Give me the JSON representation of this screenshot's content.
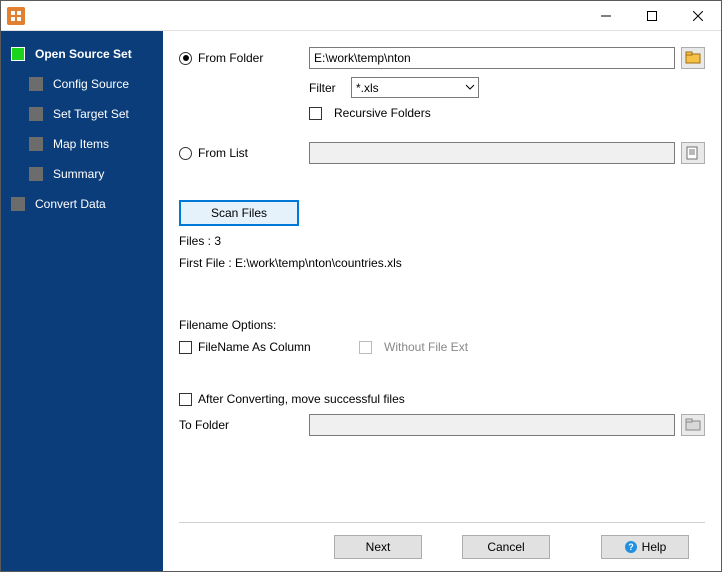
{
  "titlebar": {
    "title": ""
  },
  "sidebar": {
    "items": [
      {
        "label": "Open Source Set",
        "active": true
      },
      {
        "label": "Config Source"
      },
      {
        "label": "Set Target Set"
      },
      {
        "label": "Map Items"
      },
      {
        "label": "Summary"
      },
      {
        "label": "Convert Data"
      }
    ]
  },
  "main": {
    "from_folder_label": "From Folder",
    "from_folder_value": "E:\\work\\temp\\nton",
    "filter_label": "Filter",
    "filter_value": "*.xls",
    "recursive_label": "Recursive Folders",
    "from_list_label": "From List",
    "from_list_value": "",
    "scan_button": "Scan Files",
    "files_count_label": "Files : 3",
    "first_file_label": "First File : E:\\work\\temp\\nton\\countries.xls",
    "filename_options_label": "Filename Options:",
    "filename_as_column_label": "FileName As Column",
    "without_file_ext_label": "Without File Ext",
    "after_converting_label": "After Converting, move successful files",
    "to_folder_label": "To Folder",
    "to_folder_value": ""
  },
  "footer": {
    "next": "Next",
    "cancel": "Cancel",
    "help": "Help"
  }
}
